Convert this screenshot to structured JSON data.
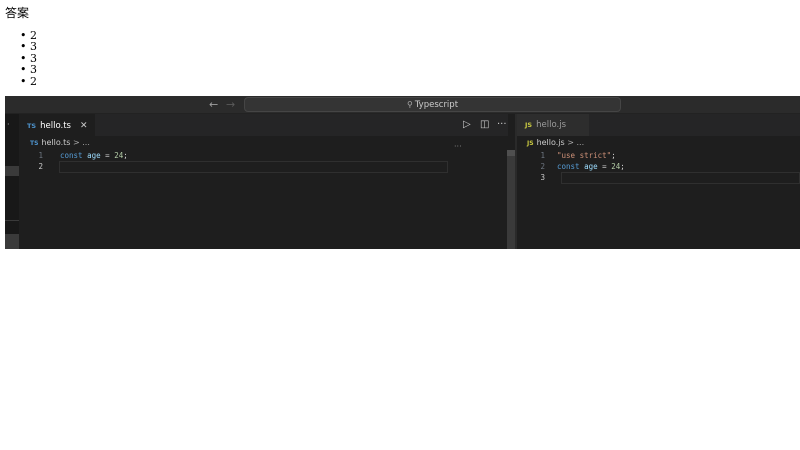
{
  "page": {
    "heading": "答案",
    "answers": [
      "2",
      "3",
      "3",
      "3",
      "2"
    ]
  },
  "titlebar": {
    "back_icon": "arrow-left-icon",
    "forward_icon": "arrow-right-icon",
    "search_label": "Typescript"
  },
  "left_editor": {
    "tab": {
      "lang_badge": "TS",
      "filename": "hello.ts"
    },
    "breadcrumb": {
      "lang_badge": "TS",
      "filename": "hello.ts",
      "separator": ">",
      "rest": "..."
    },
    "lines": [
      {
        "number": "1",
        "tokens": [
          {
            "t": "const",
            "c": "kw"
          },
          {
            "t": " "
          },
          {
            "t": "age",
            "c": "var"
          },
          {
            "t": " = ",
            "c": "op"
          },
          {
            "t": "24",
            "c": "num"
          },
          {
            "t": ";",
            "c": "punct"
          }
        ]
      },
      {
        "number": "2",
        "tokens": []
      }
    ]
  },
  "right_editor": {
    "tab": {
      "lang_badge": "JS",
      "filename": "hello.js"
    },
    "breadcrumb": {
      "lang_badge": "JS",
      "filename": "hello.js",
      "separator": ">",
      "rest": "..."
    },
    "lines": [
      {
        "number": "1",
        "tokens": [
          {
            "t": "\"use strict\"",
            "c": "str"
          },
          {
            "t": ";",
            "c": "punct"
          }
        ]
      },
      {
        "number": "2",
        "tokens": [
          {
            "t": "const",
            "c": "kw"
          },
          {
            "t": " "
          },
          {
            "t": "age",
            "c": "var"
          },
          {
            "t": " = ",
            "c": "op"
          },
          {
            "t": "24",
            "c": "num"
          },
          {
            "t": ";",
            "c": "punct"
          }
        ]
      },
      {
        "number": "3",
        "tokens": []
      }
    ]
  },
  "colors": {
    "editor_bg": "#1e1e1e",
    "keyword": "#569cd6",
    "variable": "#9cdcfe",
    "number": "#b5cea8",
    "string": "#ce9178"
  }
}
